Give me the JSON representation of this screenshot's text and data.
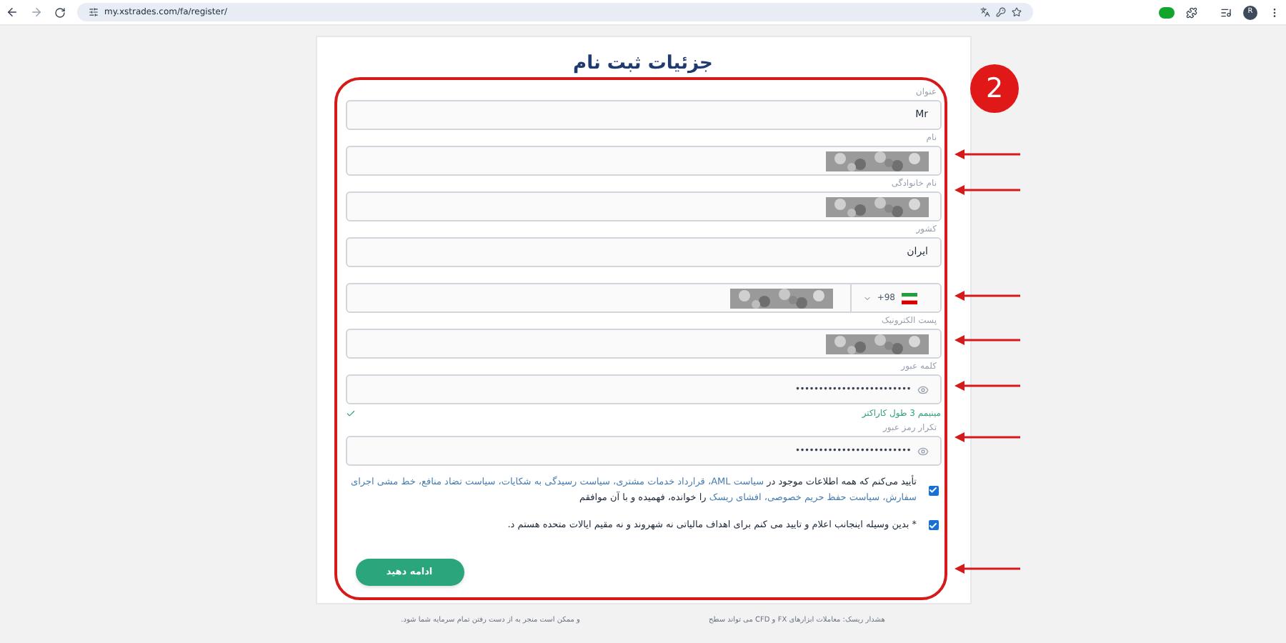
{
  "browser": {
    "url": "my.xstrades.com/fa/register/",
    "profile": "R"
  },
  "title": "جزئیات ثبت نام",
  "fields": [
    {
      "kind": "text",
      "label": "عنوان",
      "value": "Mr",
      "redacted": false
    },
    {
      "kind": "text",
      "label": "نام",
      "redacted": true
    },
    {
      "kind": "text",
      "label": "نام خانوادگی",
      "redacted": true
    },
    {
      "kind": "select",
      "label": "کشور",
      "value": "ایران",
      "redacted": false
    },
    {
      "kind": "phone",
      "code": "+98",
      "redacted": true
    },
    {
      "kind": "text",
      "label": "پست الکترونیک",
      "redacted": true
    },
    {
      "kind": "password",
      "label": "کلمه عبور",
      "value": "•••••••••••••••••••••••••",
      "hint": "مینیمم 3 طول کاراکتر",
      "valid": true
    },
    {
      "kind": "password",
      "label": "تکرار رمز عبور",
      "value": "•••••••••••••••••••••••••"
    }
  ],
  "agreements": [
    {
      "checked": true,
      "parts": [
        {
          "text": "تأیید می‌کنم که همه اطلاعات موجود در ",
          "link": false
        },
        {
          "text": "سیاست AML، قرارداد خدمات مشتری، سیاست رسیدگی به شکایات، سیاست تضاد منافع، خط مشی اجرای سفارش، سیاست حفظ حریم خصوصی، افشای ریسک",
          "link": true
        },
        {
          "text": " را خوانده، فهمیده و با آن موافقم",
          "link": false
        }
      ]
    },
    {
      "checked": true,
      "parts": [
        {
          "text": "* بدین وسیله اینجانب اعلام و تایید می کنم برای اهداف مالیاتی نه شهروند و نه مقیم ایالات متحده هستم د.",
          "link": false
        }
      ]
    }
  ],
  "submit": "ادامه دهید",
  "footer": [
    "هشدار ریسک: معاملات ابزارهای FX و CFD می تواند سطح",
    "و ممکن است منجر به از دست رفتن تمام سرمایه شما شود."
  ],
  "annotation": {
    "number": "2"
  }
}
